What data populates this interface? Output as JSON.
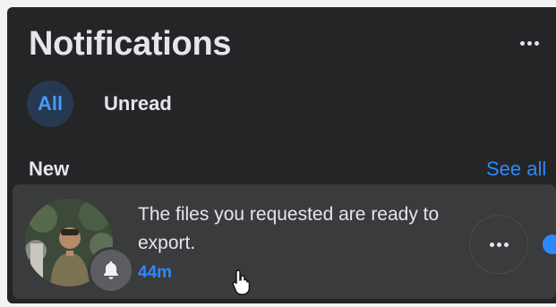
{
  "header": {
    "title": "Notifications",
    "more_icon": "ellipsis-icon"
  },
  "tabs": [
    {
      "label": "All",
      "active": true
    },
    {
      "label": "Unread",
      "active": false
    }
  ],
  "section": {
    "title": "New",
    "see_all": "See all"
  },
  "notification": {
    "text": "The files you requested are ready to export.",
    "time": "44m",
    "badge_icon": "bell-icon",
    "unread": true
  },
  "colors": {
    "panel_bg": "#242526",
    "card_bg": "#3a3b3c",
    "accent": "#2d88ff",
    "tab_active_bg": "#263951",
    "text": "#e4e6eb"
  }
}
